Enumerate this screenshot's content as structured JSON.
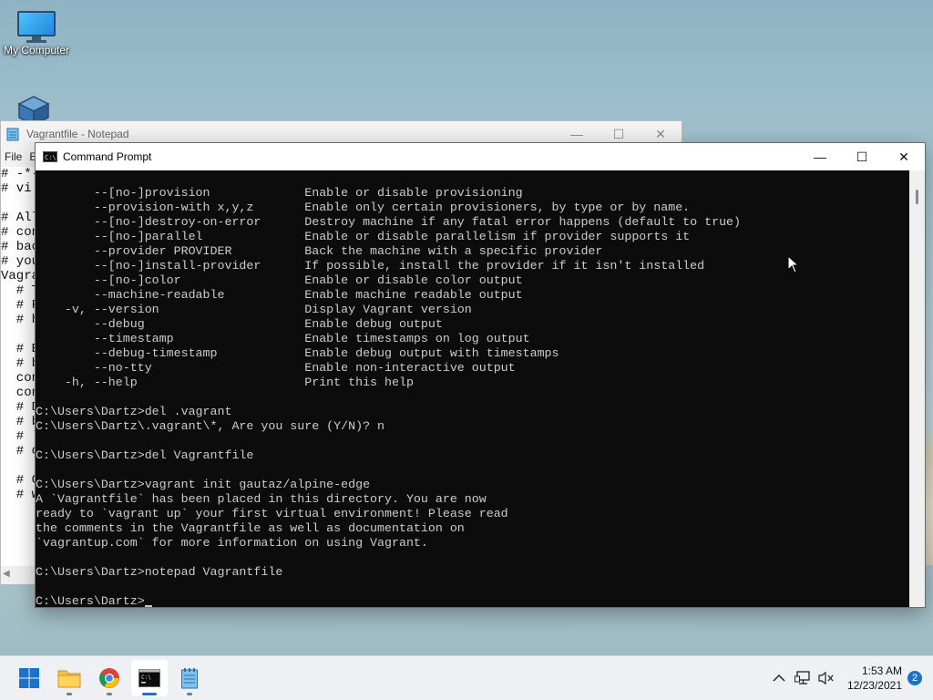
{
  "desktop": {
    "icons": [
      {
        "label": "My Computer"
      },
      {
        "label": ""
      }
    ]
  },
  "notepad": {
    "title": "Vagrantfile - Notepad",
    "menu": [
      "File",
      "E"
    ],
    "lines": [
      "# -*-",
      "# vi:",
      "",
      "# All",
      "# con",
      "# bac",
      "# you",
      "Vagra",
      "  # T",
      "  # F",
      "  # h",
      "",
      "  # E",
      "  # b",
      "  con",
      "  con",
      "  # D",
      "  # b",
      "  # `",
      "  # c",
      "",
      "  # C",
      "  # w"
    ]
  },
  "cmd": {
    "title": "Command Prompt",
    "icon_text": "C:\\",
    "lines": [
      "        --[no-]provision             Enable or disable provisioning",
      "        --provision-with x,y,z       Enable only certain provisioners, by type or by name.",
      "        --[no-]destroy-on-error      Destroy machine if any fatal error happens (default to true)",
      "        --[no-]parallel              Enable or disable parallelism if provider supports it",
      "        --provider PROVIDER          Back the machine with a specific provider",
      "        --[no-]install-provider      If possible, install the provider if it isn't installed",
      "        --[no-]color                 Enable or disable color output",
      "        --machine-readable           Enable machine readable output",
      "    -v, --version                    Display Vagrant version",
      "        --debug                      Enable debug output",
      "        --timestamp                  Enable timestamps on log output",
      "        --debug-timestamp            Enable debug output with timestamps",
      "        --no-tty                     Enable non-interactive output",
      "    -h, --help                       Print this help",
      "",
      "C:\\Users\\Dartz>del .vagrant",
      "C:\\Users\\Dartz\\.vagrant\\*, Are you sure (Y/N)? n",
      "",
      "C:\\Users\\Dartz>del Vagrantfile",
      "",
      "C:\\Users\\Dartz>vagrant init gautaz/alpine-edge",
      "A `Vagrantfile` has been placed in this directory. You are now",
      "ready to `vagrant up` your first virtual environment! Please read",
      "the comments in the Vagrantfile as well as documentation on",
      "`vagrantup.com` for more information on using Vagrant.",
      "",
      "C:\\Users\\Dartz>notepad Vagrantfile",
      ""
    ],
    "prompt": "C:\\Users\\Dartz>"
  },
  "taskbar": {
    "apps": [
      {
        "name": "start"
      },
      {
        "name": "file-explorer"
      },
      {
        "name": "chrome"
      },
      {
        "name": "command-prompt",
        "active": true
      },
      {
        "name": "notepad"
      }
    ],
    "clock": {
      "time": "1:53 AM",
      "date": "12/23/2021"
    },
    "notification_count": "2"
  },
  "colors": {
    "console_bg": "#0c0c0c",
    "console_fg": "#cccccc",
    "accent": "#1a73c8"
  }
}
